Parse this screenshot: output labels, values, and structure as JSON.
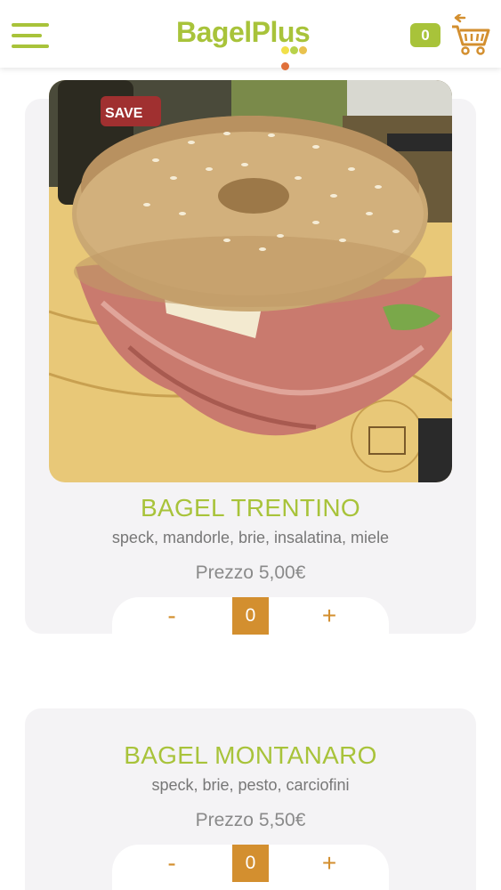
{
  "header": {
    "logo_text": "BagelPlus",
    "cart_count": "0",
    "menu_icon": "hamburger-menu-icon",
    "cart_icon": "shopping-cart-icon"
  },
  "colors": {
    "brand_green": "#a8c33a",
    "accent_orange": "#d38f2f",
    "card_bg": "#f4f3f5"
  },
  "products": [
    {
      "name": "BAGEL TRENTINO",
      "ingredients": "speck, mandorle, brie, insalatina, miele",
      "price": "Prezzo 5,00€",
      "quantity": "0",
      "minus_label": "-",
      "plus_label": "+"
    },
    {
      "name": "BAGEL MONTANARO",
      "ingredients": "speck, brie, pesto, carciofini",
      "price": "Prezzo 5,50€",
      "quantity": "0",
      "minus_label": "-",
      "plus_label": "+"
    }
  ]
}
